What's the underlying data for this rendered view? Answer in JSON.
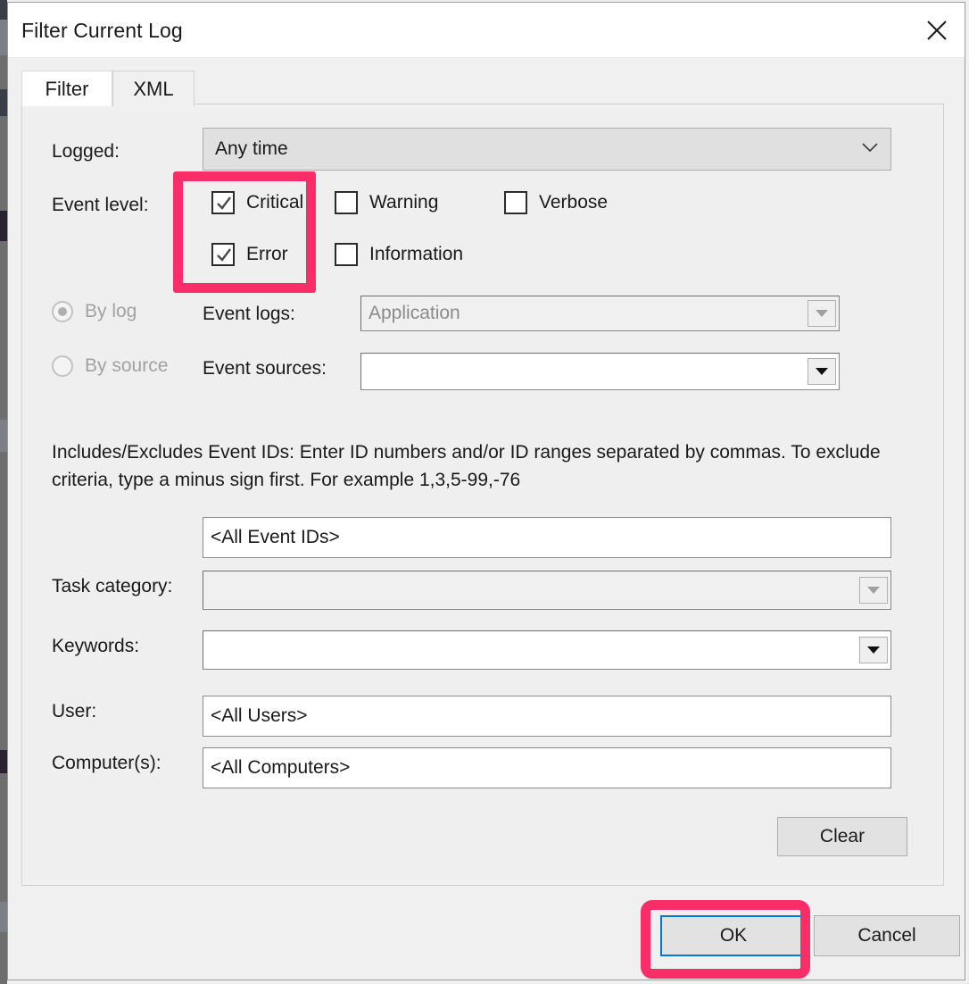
{
  "window": {
    "title": "Filter Current Log",
    "close_icon": "close-icon"
  },
  "tabs": [
    {
      "label": "Filter",
      "active": true
    },
    {
      "label": "XML",
      "active": false
    }
  ],
  "form": {
    "logged": {
      "label": "Logged:",
      "value": "Any time",
      "chevron_icon": "chevron-down-icon"
    },
    "event_level": {
      "label": "Event level:",
      "checkboxes": [
        {
          "label": "Critical",
          "checked": true
        },
        {
          "label": "Warning",
          "checked": false
        },
        {
          "label": "Verbose",
          "checked": false
        },
        {
          "label": "Error",
          "checked": true
        },
        {
          "label": "Information",
          "checked": false
        }
      ]
    },
    "source_mode": {
      "by_log": {
        "label": "By log",
        "selected": true,
        "enabled": false
      },
      "by_source": {
        "label": "By source",
        "selected": false,
        "enabled": false
      }
    },
    "event_logs": {
      "label": "Event logs:",
      "value": "Application",
      "enabled": false,
      "arrow_icon": "dropdown-arrow-icon"
    },
    "event_sources": {
      "label": "Event sources:",
      "value": "",
      "enabled": true,
      "arrow_icon": "dropdown-arrow-icon"
    },
    "event_ids_help": "Includes/Excludes Event IDs: Enter ID numbers and/or ID ranges separated by commas. To exclude criteria, type a minus sign first. For example 1,3,5-99,-76",
    "event_ids": {
      "value": "<All Event IDs>"
    },
    "task_category": {
      "label": "Task category:",
      "value": "",
      "enabled": false,
      "arrow_icon": "dropdown-arrow-icon"
    },
    "keywords": {
      "label": "Keywords:",
      "value": "",
      "enabled": true,
      "arrow_icon": "dropdown-arrow-icon"
    },
    "user": {
      "label": "User:",
      "value": "<All Users>"
    },
    "computers": {
      "label": "Computer(s):",
      "value": "<All Computers>"
    },
    "clear_button": "Clear"
  },
  "footer": {
    "ok_button": "OK",
    "cancel_button": "Cancel"
  },
  "annotations": {
    "highlight_color": "#f92d67",
    "targets": [
      "event-level-checkboxes",
      "ok-button"
    ]
  }
}
